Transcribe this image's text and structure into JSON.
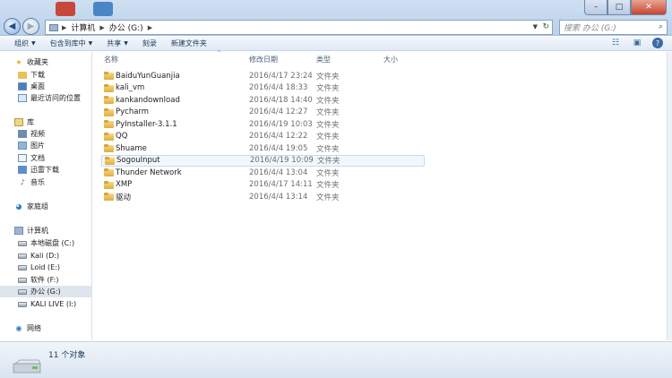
{
  "address": {
    "segments": [
      "计算机",
      "办公 (G:)"
    ],
    "search_placeholder": "搜索 办公 (G:)"
  },
  "window_controls": {
    "minimize": "–",
    "maximize": "□",
    "close": "✕"
  },
  "toolbar": {
    "organize": "组织",
    "include_in_library": "包含到库中",
    "share": "共享",
    "burn": "刻录",
    "new_folder": "新建文件夹"
  },
  "nav": {
    "favorites": "收藏夹",
    "downloads": "下载",
    "desktop": "桌面",
    "recent": "最近访问的位置",
    "libraries": "库",
    "videos": "视频",
    "pictures": "图片",
    "documents": "文档",
    "thunder": "迅雷下载",
    "music": "音乐",
    "homegroup": "家庭组",
    "computer": "计算机",
    "drive_c": "本地磁盘 (C:)",
    "drive_d": "Kali (D:)",
    "drive_e": "Loid (E:)",
    "drive_f": "软件 (F:)",
    "drive_g": "办公 (G:)",
    "drive_kali": "KALI LIVE (I:)",
    "network": "网络"
  },
  "columns": {
    "name": "名称",
    "date": "修改日期",
    "type": "类型",
    "size": "大小"
  },
  "files": [
    {
      "name": "BaiduYunGuanjia",
      "date": "2016/4/17 23:24",
      "type": "文件夹"
    },
    {
      "name": "kali_vm",
      "date": "2016/4/4 18:33",
      "type": "文件夹"
    },
    {
      "name": "kankandownload",
      "date": "2016/4/18 14:40",
      "type": "文件夹"
    },
    {
      "name": "Pycharm",
      "date": "2016/4/4 12:27",
      "type": "文件夹"
    },
    {
      "name": "PyInstaller-3.1.1",
      "date": "2016/4/19 10:03",
      "type": "文件夹"
    },
    {
      "name": "QQ",
      "date": "2016/4/4 12:22",
      "type": "文件夹"
    },
    {
      "name": "Shuame",
      "date": "2016/4/4 19:05",
      "type": "文件夹"
    },
    {
      "name": "SogouInput",
      "date": "2016/4/19 10:09",
      "type": "文件夹"
    },
    {
      "name": "Thunder Network",
      "date": "2016/4/4 13:04",
      "type": "文件夹"
    },
    {
      "name": "XMP",
      "date": "2016/4/17 14:11",
      "type": "文件夹"
    },
    {
      "name": "驱动",
      "date": "2016/4/4 13:14",
      "type": "文件夹"
    }
  ],
  "status": {
    "count": "11 个对象"
  }
}
